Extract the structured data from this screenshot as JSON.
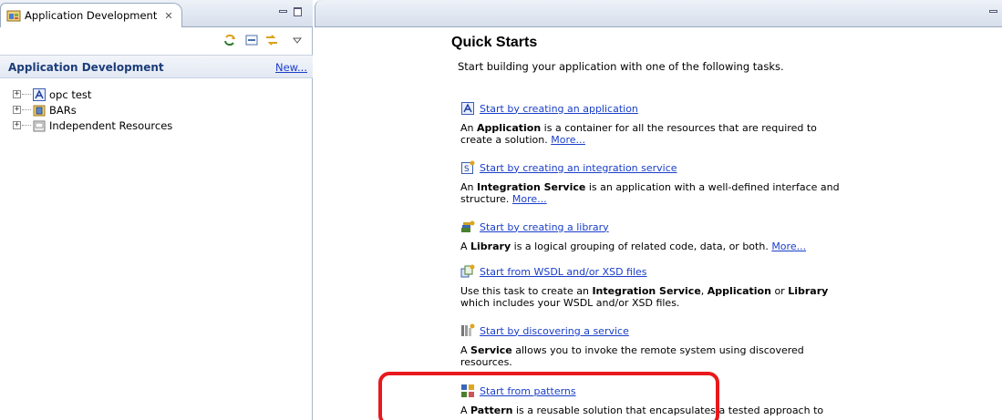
{
  "left_view": {
    "tab_title": "Application Development",
    "tab_close": "✕",
    "header_title": "Application Development",
    "header_new_link": "New...",
    "tree": [
      {
        "label": "opc test",
        "icon": "application-icon",
        "expander": "+"
      },
      {
        "label": "BARs",
        "icon": "bar-folder-icon",
        "expander": "+"
      },
      {
        "label": "Independent Resources",
        "icon": "resources-folder-icon",
        "expander": "+"
      }
    ]
  },
  "quick_starts": {
    "title": "Quick Starts",
    "intro": "Start building your application with one of the following tasks.",
    "tasks": [
      {
        "icon": "application-icon",
        "link": "Start by creating an application",
        "desc_pre": "An ",
        "desc_bold": "Application",
        "desc_line1_rest": " is a container for all the resources that are required to",
        "desc_line2": "create a solution. ",
        "more": "More..."
      },
      {
        "icon": "integration-service-icon",
        "link": "Start by creating an integration service",
        "desc_pre": "An ",
        "desc_bold": "Integration Service",
        "desc_line1_rest": " is an application with a well-defined interface and",
        "desc_line2": "structure. ",
        "more": "More..."
      },
      {
        "icon": "library-icon",
        "link": "Start by creating a library",
        "desc_pre": "A ",
        "desc_bold": "Library",
        "desc_line1_rest": " is a logical grouping of related code, data, or both. ",
        "more": "More..."
      },
      {
        "icon": "wsdl-xsd-icon",
        "link": "Start from WSDL and/or XSD files",
        "desc_pre": "Use this task to create an ",
        "desc_bold": "Integration Service",
        "desc_mid": ", ",
        "desc_bold2": "Application",
        "desc_mid2": " or ",
        "desc_bold3": "Library",
        "desc_line2": "which includes your WSDL and/or XSD files."
      },
      {
        "icon": "discover-service-icon",
        "link": "Start by discovering a service",
        "desc_pre": "A ",
        "desc_bold": "Service",
        "desc_line1_rest": " allows you to invoke the remote system using discovered",
        "desc_line2": "resources."
      },
      {
        "icon": "patterns-icon",
        "link": "Start from patterns",
        "desc_pre": "A ",
        "desc_bold": "Pattern",
        "desc_line1_rest": " is a reusable solution that encapsulates a tested approach to"
      }
    ]
  },
  "colors": {
    "link": "#1a3ec9",
    "header_title": "#1c3d7a",
    "highlight": "#e8191d"
  }
}
